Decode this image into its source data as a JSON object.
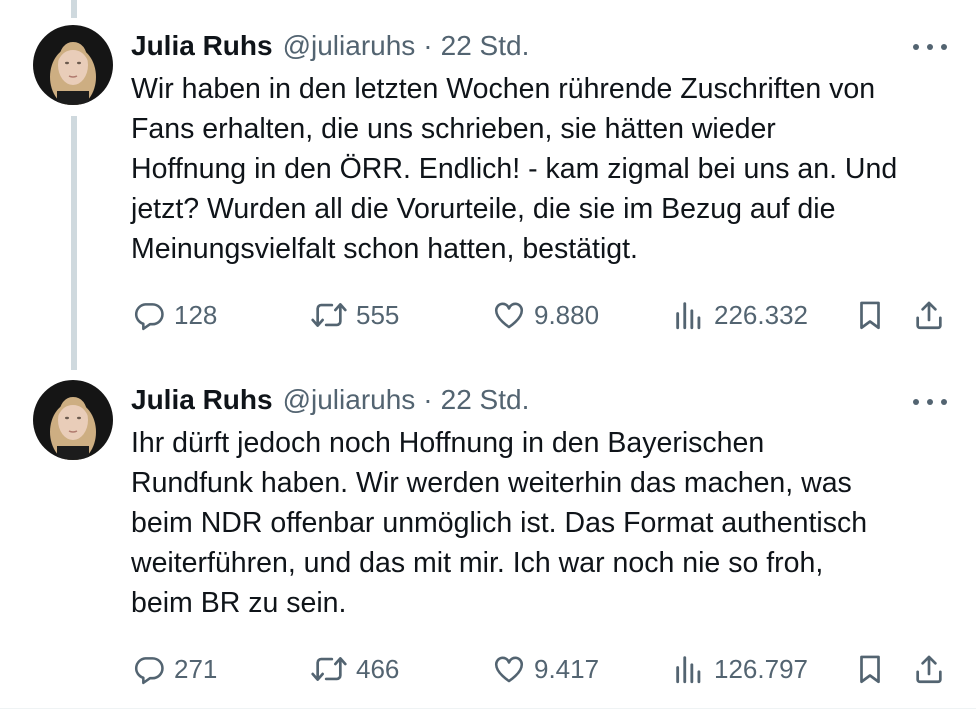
{
  "colors": {
    "text": "#0f1419",
    "secondary": "#536471",
    "thread_line": "#cfd9de",
    "divider": "#eff3f4"
  },
  "tweets": [
    {
      "author": "Julia Ruhs",
      "handle": "@juliaruhs",
      "separator": "·",
      "time": "22 Std.",
      "text": "Wir haben in den letzten Wochen rührende Zuschriften von\nFans erhalten, die uns schrieben, sie hätten wieder\nHoffnung in den ÖRR. Endlich! - kam zigmal bei uns an. Und\njetzt? Wurden all die Vorurteile, die sie im Bezug auf die\nMeinungsvielfalt schon hatten, bestätigt.",
      "replies": "128",
      "reposts": "555",
      "likes": "9.880",
      "views": "226.332"
    },
    {
      "author": "Julia Ruhs",
      "handle": "@juliaruhs",
      "separator": "·",
      "time": "22 Std.",
      "text": "Ihr dürft jedoch noch Hoffnung in den Bayerischen\nRundfunk haben. Wir werden weiterhin das machen, was\nbeim NDR offenbar unmöglich ist. Das Format authentisch\nweiterführen, und das mit mir. Ich war noch nie so froh,\nbeim BR zu sein.",
      "replies": "271",
      "reposts": "466",
      "likes": "9.417",
      "views": "126.797"
    }
  ],
  "icons": {
    "reply": "reply-icon",
    "repost": "repost-icon",
    "like": "heart-icon",
    "views": "views-icon",
    "bookmark": "bookmark-icon",
    "share": "share-icon",
    "more": "more-icon"
  }
}
